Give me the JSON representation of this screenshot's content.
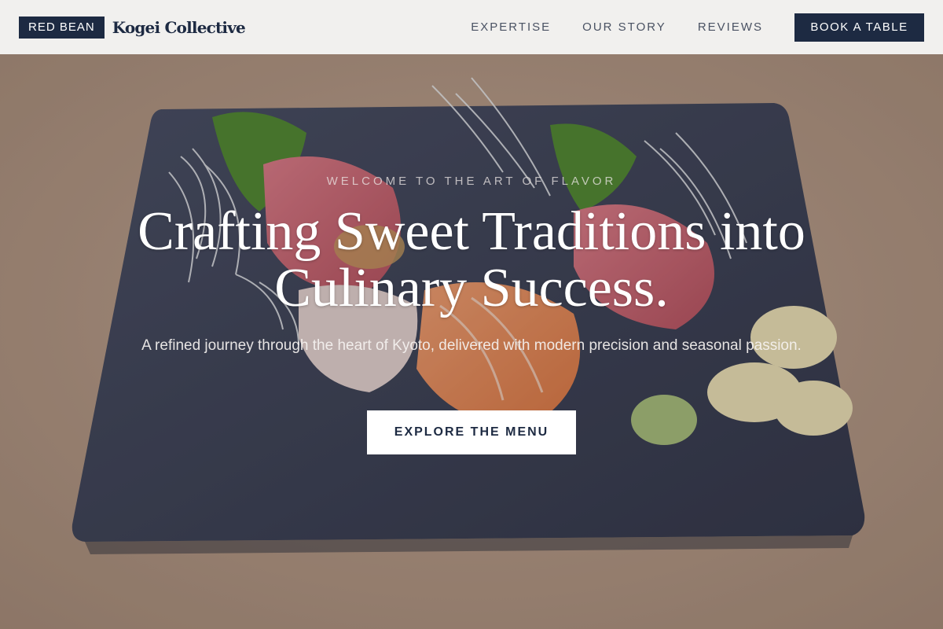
{
  "nav": {
    "badge": "RED BEAN",
    "brand_name": "Kogei Collective",
    "links": [
      {
        "label": "EXPERTISE"
      },
      {
        "label": "OUR STORY"
      },
      {
        "label": "REVIEWS"
      }
    ],
    "cta_label": "BOOK A TABLE"
  },
  "hero": {
    "eyebrow": "WELCOME TO THE ART OF FLAVOR",
    "headline": "Crafting Sweet Traditions into Culinary Success.",
    "subtitle": "A refined journey through the heart of Kyoto, delivered with modern precision and seasonal passion.",
    "cta_label": "EXPLORE THE MENU",
    "image": "sashimi-platter-on-slate"
  },
  "colors": {
    "navy": "#1d2a42",
    "nav_bg": "#f1f0ee",
    "table_wood": "#b89c86",
    "slate": "#3c4258"
  }
}
